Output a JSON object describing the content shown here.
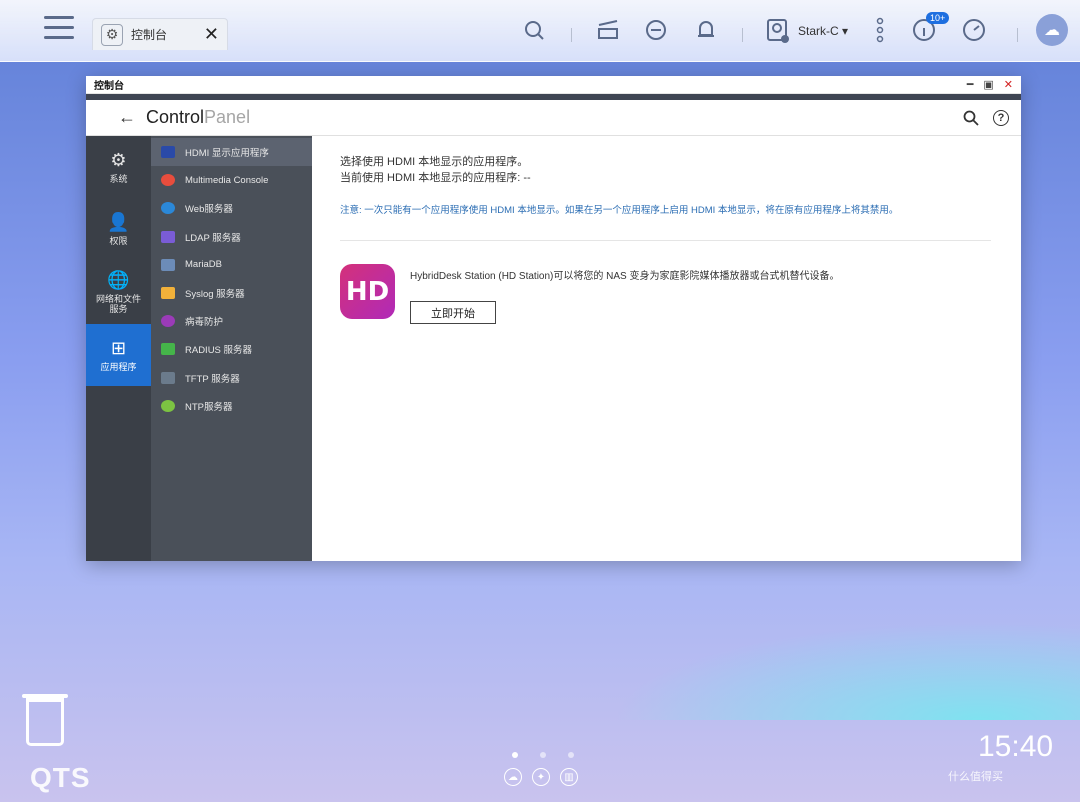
{
  "topbar": {
    "tab_title": "控制台",
    "tab_icon": "gear-icon",
    "user_name": "Stark-C ▾",
    "notification_badge": "10+"
  },
  "window": {
    "title": "控制台",
    "header_title_main": "Control",
    "header_title_sub": "Panel"
  },
  "rail": [
    {
      "label": "系统",
      "icon": "gear-icon"
    },
    {
      "label": "权限",
      "icon": "user-icon"
    },
    {
      "label": "网络和文件\n服务",
      "icon": "globe-icon"
    },
    {
      "label": "应用程序",
      "icon": "apps-icon",
      "active": true
    }
  ],
  "subnav": [
    {
      "label": "HDMI 显示应用程序",
      "color": "#2a4aa8"
    },
    {
      "label": "Multimedia Console",
      "color": "#e84d3d"
    },
    {
      "label": "Web服务器",
      "color": "#2b88d8"
    },
    {
      "label": "LDAP 服务器",
      "color": "#7a5cd6"
    },
    {
      "label": "MariaDB",
      "color": "#6c8cb8"
    },
    {
      "label": "Syslog 服务器",
      "color": "#f2b13a"
    },
    {
      "label": "病毒防护",
      "color": "#9b3bb8"
    },
    {
      "label": "RADIUS 服务器",
      "color": "#45b54a"
    },
    {
      "label": "TFTP 服务器",
      "color": "#6b7b8c"
    },
    {
      "label": "NTP服务器",
      "color": "#7cc342"
    }
  ],
  "content": {
    "line1": "选择使用 HDMI 本地显示的应用程序。",
    "line2": "当前使用 HDMI 本地显示的应用程序: --",
    "note": "注意: 一次只能有一个应用程序使用 HDMI 本地显示。如果在另一个应用程序上启用 HDMI 本地显示，将在原有应用程序上将其禁用。",
    "app_logo_text": "HD",
    "app_desc": "HybridDesk Station (HD Station)可以将您的 NAS 变身为家庭影院媒体播放器或台式机替代设备。",
    "start_button": "立即开始"
  },
  "desktop": {
    "os_logo": "QTS",
    "clock": "15:40",
    "watermark": "什么值得买"
  }
}
